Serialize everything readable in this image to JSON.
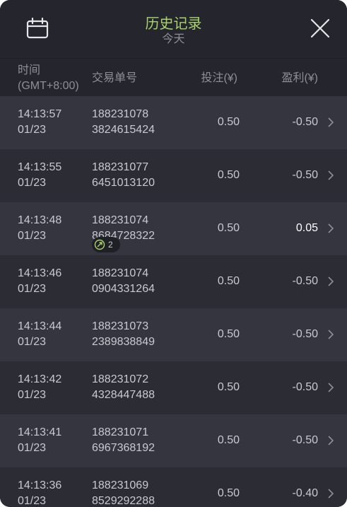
{
  "header": {
    "title": "历史记录",
    "subtitle": "今天"
  },
  "columns": {
    "time": "时间",
    "timezone": "(GMT+8:00)",
    "order": "交易单号",
    "bet": "投注(¥)",
    "profit": "盈利(¥)"
  },
  "colors": {
    "accent": "#a9d36b",
    "badge_icon": "#a9d36b"
  },
  "rows": [
    {
      "time": "14:13:57",
      "date": "01/23",
      "order_line1": "188231078",
      "order_line2": "3824615424",
      "bet": "0.50",
      "profit": "-0.50"
    },
    {
      "time": "14:13:55",
      "date": "01/23",
      "order_line1": "188231077",
      "order_line2": "6451013120",
      "bet": "0.50",
      "profit": "-0.50"
    },
    {
      "time": "14:13:48",
      "date": "01/23",
      "order_line1": "188231074",
      "order_line2": "8684728322",
      "bet": "0.50",
      "profit": "0.05",
      "badge": "2"
    },
    {
      "time": "14:13:46",
      "date": "01/23",
      "order_line1": "188231074",
      "order_line2": "0904331264",
      "bet": "0.50",
      "profit": "-0.50"
    },
    {
      "time": "14:13:44",
      "date": "01/23",
      "order_line1": "188231073",
      "order_line2": "2389838849",
      "bet": "0.50",
      "profit": "-0.50"
    },
    {
      "time": "14:13:42",
      "date": "01/23",
      "order_line1": "188231072",
      "order_line2": "4328447488",
      "bet": "0.50",
      "profit": "-0.50"
    },
    {
      "time": "14:13:41",
      "date": "01/23",
      "order_line1": "188231071",
      "order_line2": "6967368192",
      "bet": "0.50",
      "profit": "-0.50"
    },
    {
      "time": "14:13:36",
      "date": "01/23",
      "order_line1": "188231069",
      "order_line2": "8529292288",
      "bet": "0.50",
      "profit": "-0.40"
    }
  ]
}
